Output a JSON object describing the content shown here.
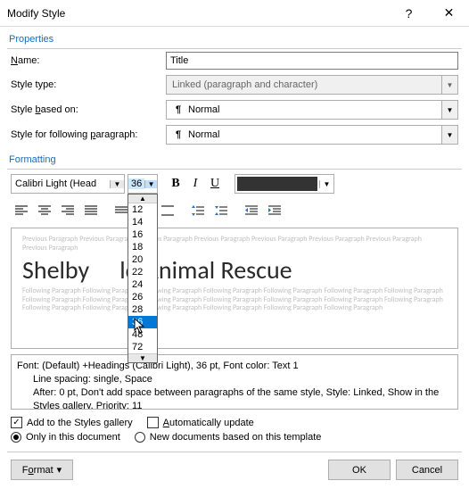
{
  "titlebar": {
    "title": "Modify Style",
    "help": "?",
    "close": "✕"
  },
  "sections": {
    "properties": "Properties",
    "formatting": "Formatting"
  },
  "form": {
    "name_label_pre": "",
    "name_label": "Name:",
    "name_u": "N",
    "name_rest": "ame:",
    "name_value": "Title",
    "styletype_label": "Style type:",
    "styletype_value": "Linked (paragraph and character)",
    "basedon_pre": "Style ",
    "basedon_u": "b",
    "basedon_rest": "ased on:",
    "basedon_value": "Normal",
    "following_pre": "Style for following ",
    "following_u": "p",
    "following_rest": "aragraph:",
    "following_value": "Normal"
  },
  "toolbar": {
    "font": "Calibri Light (Head",
    "size": "36"
  },
  "size_options": [
    "12",
    "14",
    "16",
    "18",
    "20",
    "22",
    "24",
    "26",
    "28",
    "36",
    "48",
    "72"
  ],
  "preview": {
    "ghost_before": "Previous Paragraph Previous Paragraph Previous Paragraph Previous Paragraph Previous Paragraph Previous Paragraph Previous Paragraph Previous Paragraph",
    "title_left": "Shelby",
    "title_right": "ld Animal Rescue",
    "ghost_after": "Following Paragraph Following Paragraph Following Paragraph Following Paragraph Following Paragraph Following Paragraph Following Paragraph Following Paragraph Following Paragraph Following Paragraph Following Paragraph Following Paragraph Following Paragraph Following Paragraph Following Paragraph Following Paragraph Following Paragraph Following Paragraph Following Paragraph Following Paragraph"
  },
  "description": {
    "line1": "Font: (Default) +Headings (Calibri Light), 36 pt, Font color: Text 1",
    "line2": "Line spacing:  single, Space",
    "line3": "After:  0 pt, Don't add space between paragraphs of the same style, Style: Linked, Show in the Styles gallery, Priority: 11"
  },
  "options": {
    "add_gallery": "Add to the Styles gallery",
    "auto_update_pre": "A",
    "auto_update_rest": "utomatically update",
    "only_doc": "Only in this document",
    "new_docs": "New documents based on this template"
  },
  "buttons": {
    "format_pre": "F",
    "format_u": "o",
    "format_rest": "rmat",
    "caret": "▾",
    "ok": "OK",
    "cancel": "Cancel"
  }
}
